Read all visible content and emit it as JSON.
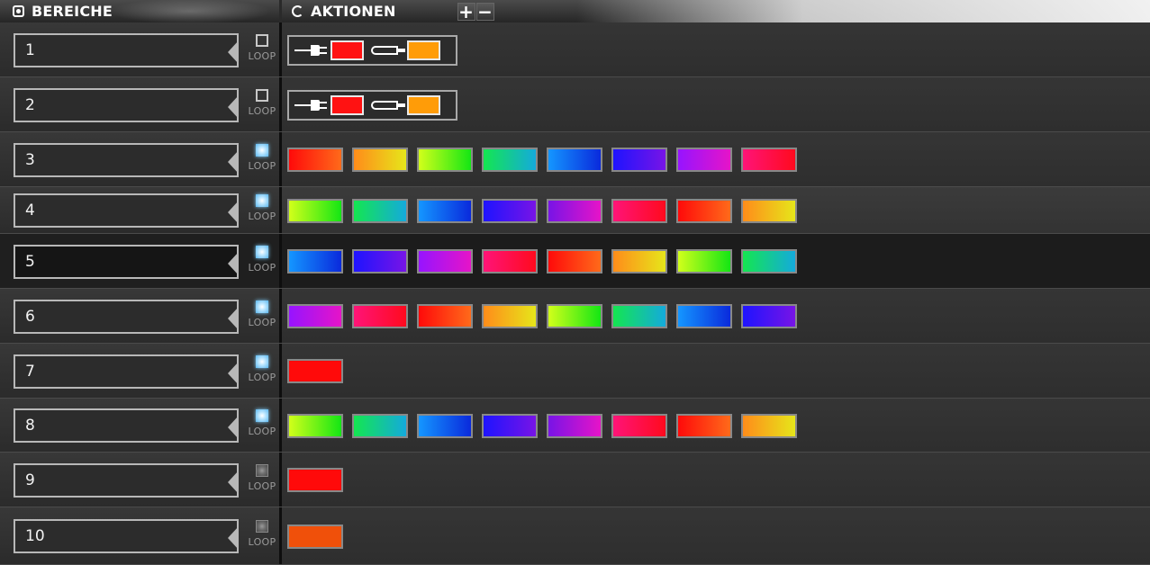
{
  "header": {
    "areas_title": "BEREICHE",
    "actions_title": "AKTIONEN",
    "add_label": "+",
    "remove_label": "−"
  },
  "colors": {
    "red": "#ff1414",
    "orange": "#ff9a0a"
  },
  "rows": [
    {
      "name": "1",
      "loop_label": "LOOP",
      "loop_state": "off",
      "type": "device",
      "device_colors": [
        "#ff1212",
        "#ff9c08"
      ]
    },
    {
      "name": "2",
      "loop_label": "LOOP",
      "loop_state": "off",
      "type": "device",
      "device_colors": [
        "#ff1212",
        "#ff9c08"
      ]
    },
    {
      "name": "3",
      "loop_label": "LOOP",
      "loop_state": "on",
      "type": "swatches",
      "swatches": [
        [
          "#ff0a0a",
          "#ff6a1a"
        ],
        [
          "#ff8c1a",
          "#e6e61a"
        ],
        [
          "#d2ff1a",
          "#14e614"
        ],
        [
          "#14e650",
          "#14aadc"
        ],
        [
          "#1496ff",
          "#0a2adc"
        ],
        [
          "#1e14ff",
          "#7814e6"
        ],
        [
          "#9614ff",
          "#e614c8"
        ],
        [
          "#ff1478",
          "#ff0a1e"
        ]
      ]
    },
    {
      "name": "4",
      "loop_label": "LOOP",
      "loop_state": "on",
      "type": "swatches",
      "swatches": [
        [
          "#d2ff1a",
          "#14e614"
        ],
        [
          "#14e650",
          "#14aadc"
        ],
        [
          "#1496ff",
          "#0a2adc"
        ],
        [
          "#1e14ff",
          "#7814e6"
        ],
        [
          "#7814e6",
          "#e614c8"
        ],
        [
          "#ff1478",
          "#ff0a1e"
        ],
        [
          "#ff0a0a",
          "#ff6a1a"
        ],
        [
          "#ff8c1a",
          "#e6e61a"
        ]
      ]
    },
    {
      "name": "5",
      "loop_label": "LOOP",
      "loop_state": "on",
      "type": "swatches",
      "swatches": [
        [
          "#1496ff",
          "#0a2adc"
        ],
        [
          "#1e14ff",
          "#7814e6"
        ],
        [
          "#9614ff",
          "#e614c8"
        ],
        [
          "#ff1478",
          "#ff0a1e"
        ],
        [
          "#ff0a0a",
          "#ff6a1a"
        ],
        [
          "#ff8c1a",
          "#e6e61a"
        ],
        [
          "#d2ff1a",
          "#14e614"
        ],
        [
          "#14e650",
          "#14aadc"
        ]
      ]
    },
    {
      "name": "6",
      "loop_label": "LOOP",
      "loop_state": "on",
      "type": "swatches",
      "swatches": [
        [
          "#9614ff",
          "#e614c8"
        ],
        [
          "#ff1478",
          "#ff0a1e"
        ],
        [
          "#ff0a0a",
          "#ff6a1a"
        ],
        [
          "#ff8c1a",
          "#e6e61a"
        ],
        [
          "#d2ff1a",
          "#14e614"
        ],
        [
          "#14e650",
          "#14aadc"
        ],
        [
          "#1496ff",
          "#0a2adc"
        ],
        [
          "#1e14ff",
          "#7814e6"
        ]
      ]
    },
    {
      "name": "7",
      "loop_label": "LOOP",
      "loop_state": "on",
      "type": "swatches",
      "swatches": [
        [
          "#ff0a0a",
          "#ff0a0a"
        ]
      ]
    },
    {
      "name": "8",
      "loop_label": "LOOP",
      "loop_state": "on",
      "type": "swatches",
      "swatches": [
        [
          "#d2ff1a",
          "#14e614"
        ],
        [
          "#14e650",
          "#14aadc"
        ],
        [
          "#1496ff",
          "#0a2adc"
        ],
        [
          "#1e14ff",
          "#7814e6"
        ],
        [
          "#7814e6",
          "#e614c8"
        ],
        [
          "#ff1478",
          "#ff0a1e"
        ],
        [
          "#ff0a0a",
          "#ff6a1a"
        ],
        [
          "#ff8c1a",
          "#e6e61a"
        ]
      ]
    },
    {
      "name": "9",
      "loop_label": "LOOP",
      "loop_state": "disabled",
      "type": "swatches",
      "swatches": [
        [
          "#ff0a0a",
          "#ff0a0a"
        ]
      ]
    },
    {
      "name": "10",
      "loop_label": "LOOP",
      "loop_state": "disabled",
      "type": "swatches",
      "swatches": [
        [
          "#f0500a",
          "#f0500a"
        ]
      ]
    }
  ]
}
